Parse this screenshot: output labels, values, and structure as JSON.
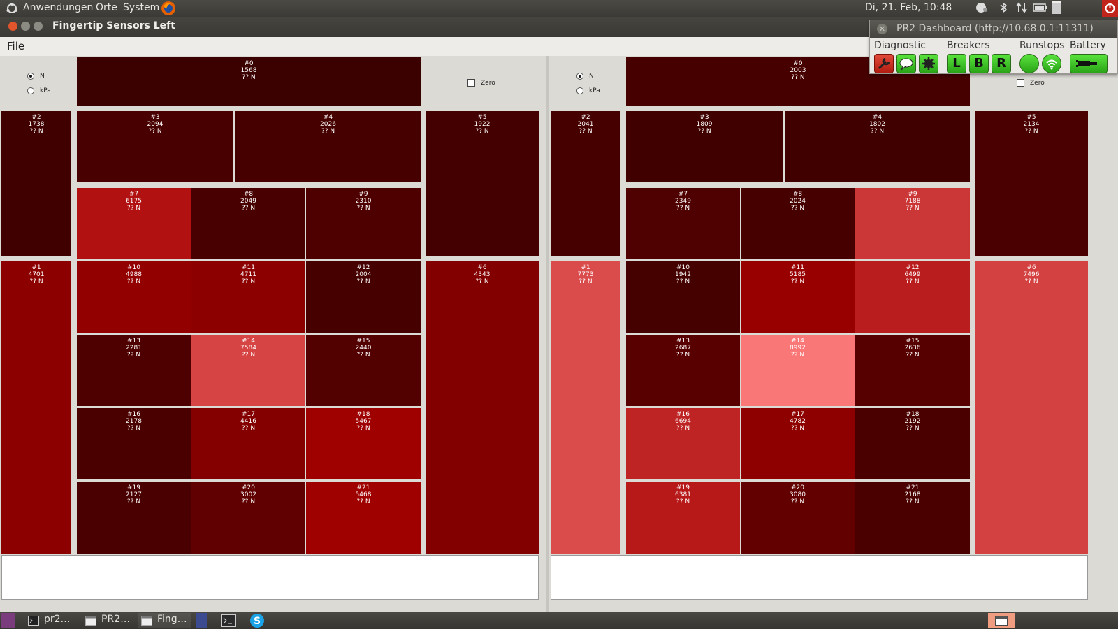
{
  "topbar": {
    "menus": [
      "Anwendungen",
      "Orte",
      "System"
    ],
    "clock": "Di, 21. Feb, 10:48"
  },
  "window": {
    "title": "Fingertip Sensors Left",
    "menu_file": "File"
  },
  "units": {
    "n_label": "N",
    "kpa_label": "kPa",
    "zero_label": "Zero",
    "selected": "N"
  },
  "value_unit_text": "?? N",
  "left_sensors": [
    {
      "id": "#0",
      "value": "1568"
    },
    {
      "id": "#1",
      "value": "4701"
    },
    {
      "id": "#2",
      "value": "1738"
    },
    {
      "id": "#3",
      "value": "2094"
    },
    {
      "id": "#4",
      "value": "2026"
    },
    {
      "id": "#5",
      "value": "1922"
    },
    {
      "id": "#6",
      "value": "4343"
    },
    {
      "id": "#7",
      "value": "6175"
    },
    {
      "id": "#8",
      "value": "2049"
    },
    {
      "id": "#9",
      "value": "2310"
    },
    {
      "id": "#10",
      "value": "4988"
    },
    {
      "id": "#11",
      "value": "4711"
    },
    {
      "id": "#12",
      "value": "2004"
    },
    {
      "id": "#13",
      "value": "2281"
    },
    {
      "id": "#14",
      "value": "7584"
    },
    {
      "id": "#15",
      "value": "2440"
    },
    {
      "id": "#16",
      "value": "2178"
    },
    {
      "id": "#17",
      "value": "4416"
    },
    {
      "id": "#18",
      "value": "5467"
    },
    {
      "id": "#19",
      "value": "2127"
    },
    {
      "id": "#20",
      "value": "3002"
    },
    {
      "id": "#21",
      "value": "5468"
    }
  ],
  "right_sensors": [
    {
      "id": "#0",
      "value": "2003"
    },
    {
      "id": "#1",
      "value": "7773"
    },
    {
      "id": "#2",
      "value": "2041"
    },
    {
      "id": "#3",
      "value": "1809"
    },
    {
      "id": "#4",
      "value": "1802"
    },
    {
      "id": "#5",
      "value": "2134"
    },
    {
      "id": "#6",
      "value": "7496"
    },
    {
      "id": "#7",
      "value": "2349"
    },
    {
      "id": "#8",
      "value": "2024"
    },
    {
      "id": "#9",
      "value": "7188"
    },
    {
      "id": "#10",
      "value": "1942"
    },
    {
      "id": "#11",
      "value": "5185"
    },
    {
      "id": "#12",
      "value": "6499"
    },
    {
      "id": "#13",
      "value": "2687"
    },
    {
      "id": "#14",
      "value": "8992"
    },
    {
      "id": "#15",
      "value": "2636"
    },
    {
      "id": "#16",
      "value": "6694"
    },
    {
      "id": "#17",
      "value": "4782"
    },
    {
      "id": "#18",
      "value": "2192"
    },
    {
      "id": "#19",
      "value": "6381"
    },
    {
      "id": "#20",
      "value": "3080"
    },
    {
      "id": "#21",
      "value": "2168"
    }
  ],
  "dashboard": {
    "title": "PR2 Dashboard (http://10.68.0.1:11311)",
    "diagnostic_label": "Diagnostic",
    "breakers_label": "Breakers",
    "runstops_label": "Runstops",
    "battery_label": "Battery",
    "breaker_left": "L",
    "breaker_base": "B",
    "breaker_right": "R"
  },
  "taskbar": {
    "items": [
      "pr2…",
      "PR2…",
      "Fing…"
    ]
  }
}
